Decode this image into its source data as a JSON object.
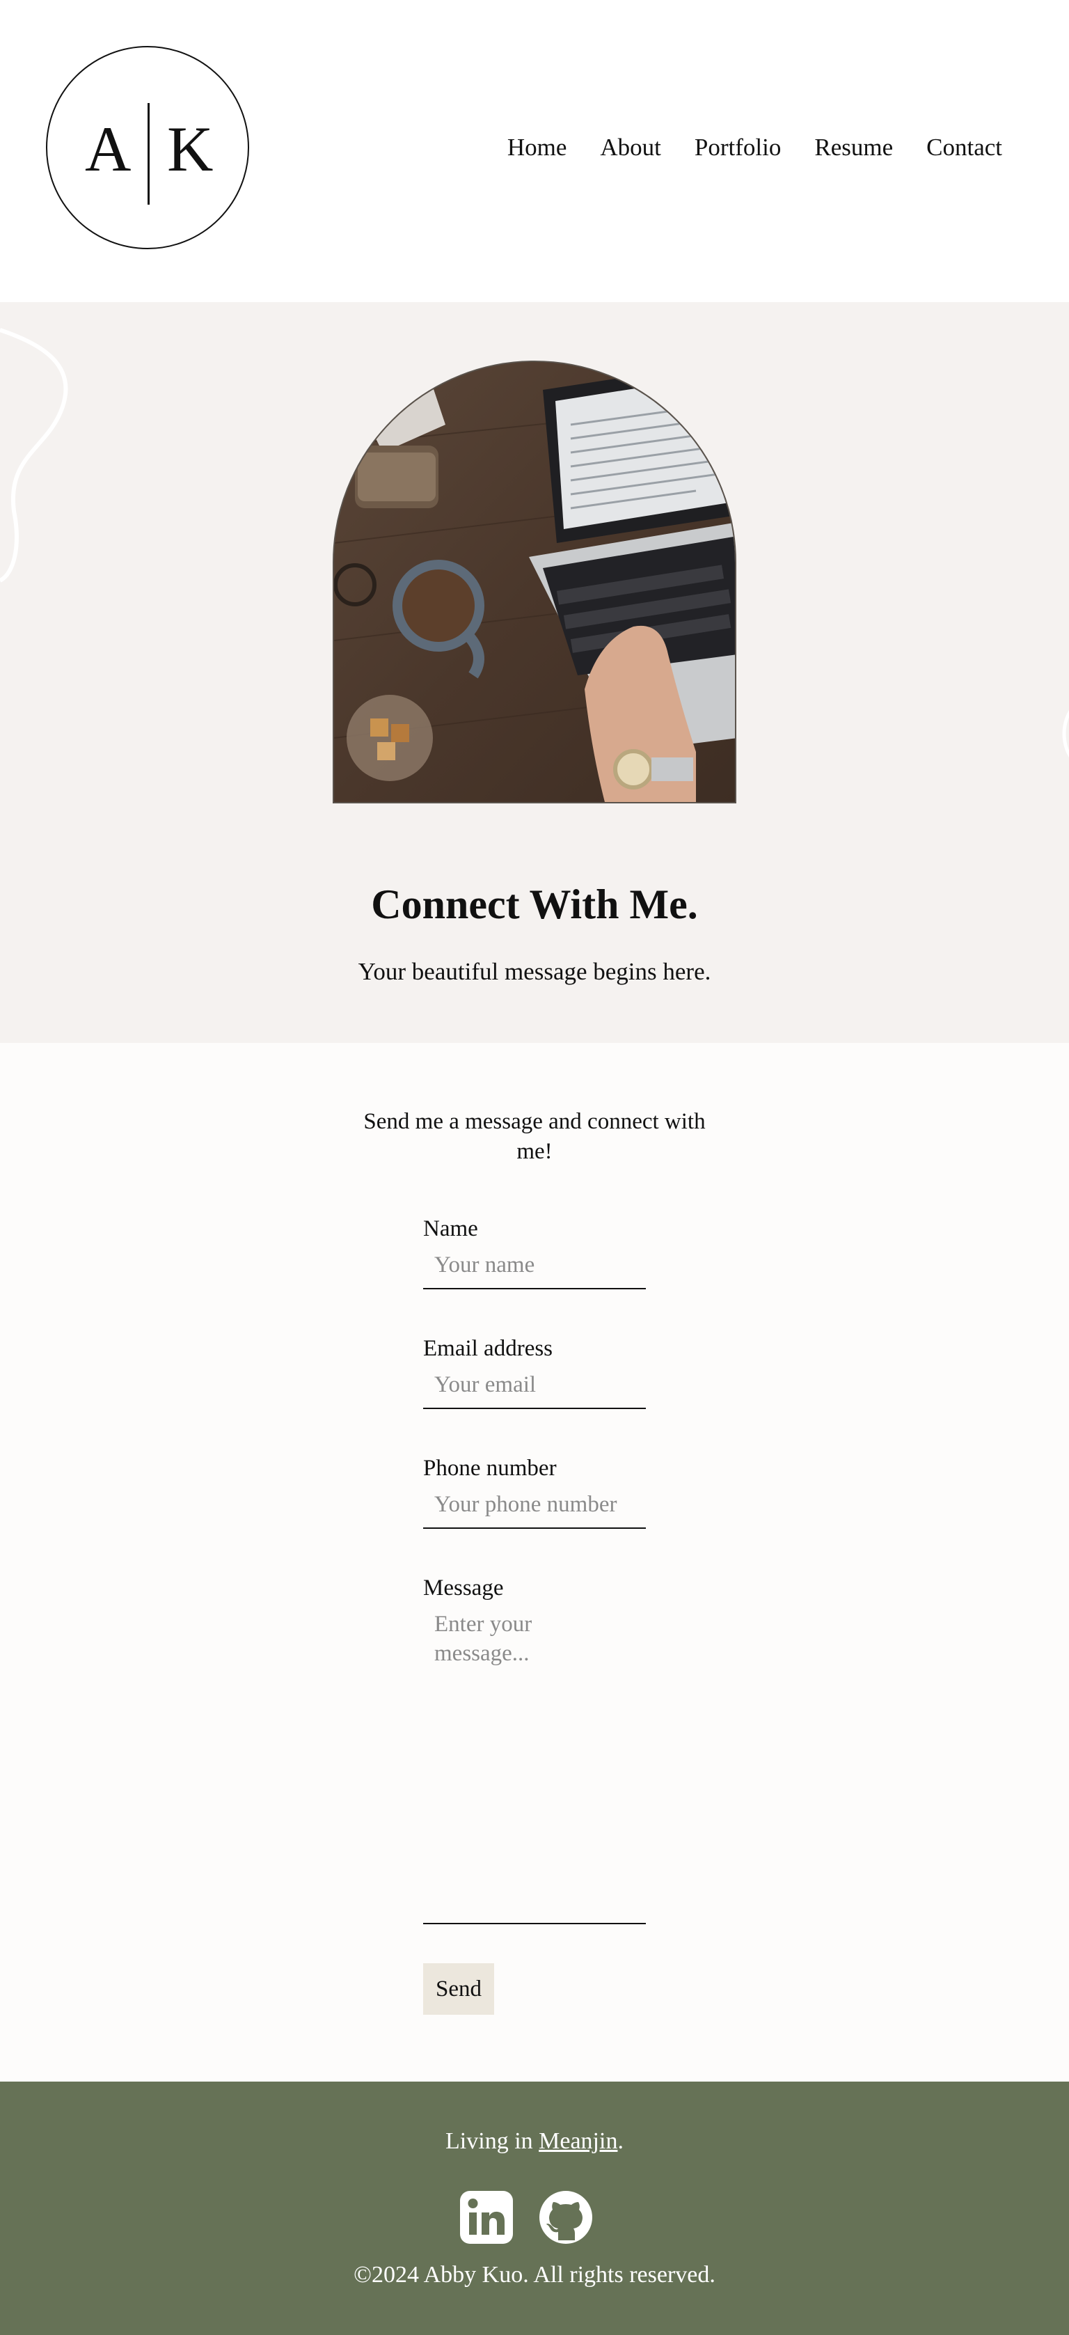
{
  "logo": {
    "left_letter": "A",
    "right_letter": "K"
  },
  "nav": {
    "items": [
      "Home",
      "About",
      "Portfolio",
      "Resume",
      "Contact"
    ]
  },
  "hero": {
    "title": "Connect With Me.",
    "subtitle": "Your beautiful message begins here."
  },
  "form": {
    "intro": "Send me a message and connect with me!",
    "name_label": "Name",
    "name_placeholder": "Your name",
    "email_label": "Email address",
    "email_placeholder": "Your email",
    "phone_label": "Phone number",
    "phone_placeholder": "Your phone number",
    "message_label": "Message",
    "message_placeholder": "Enter your message...",
    "send_label": "Send"
  },
  "footer": {
    "living_prefix": "Living in ",
    "city": "Meanjin",
    "living_suffix": ".",
    "copyright": "©2024 Abby Kuo. All rights reserved.",
    "icons": [
      "linkedin-icon",
      "github-icon"
    ]
  },
  "colors": {
    "hero_bg": "#f5f2f0",
    "footer_bg": "#667256",
    "send_bg": "#ece7dd"
  }
}
